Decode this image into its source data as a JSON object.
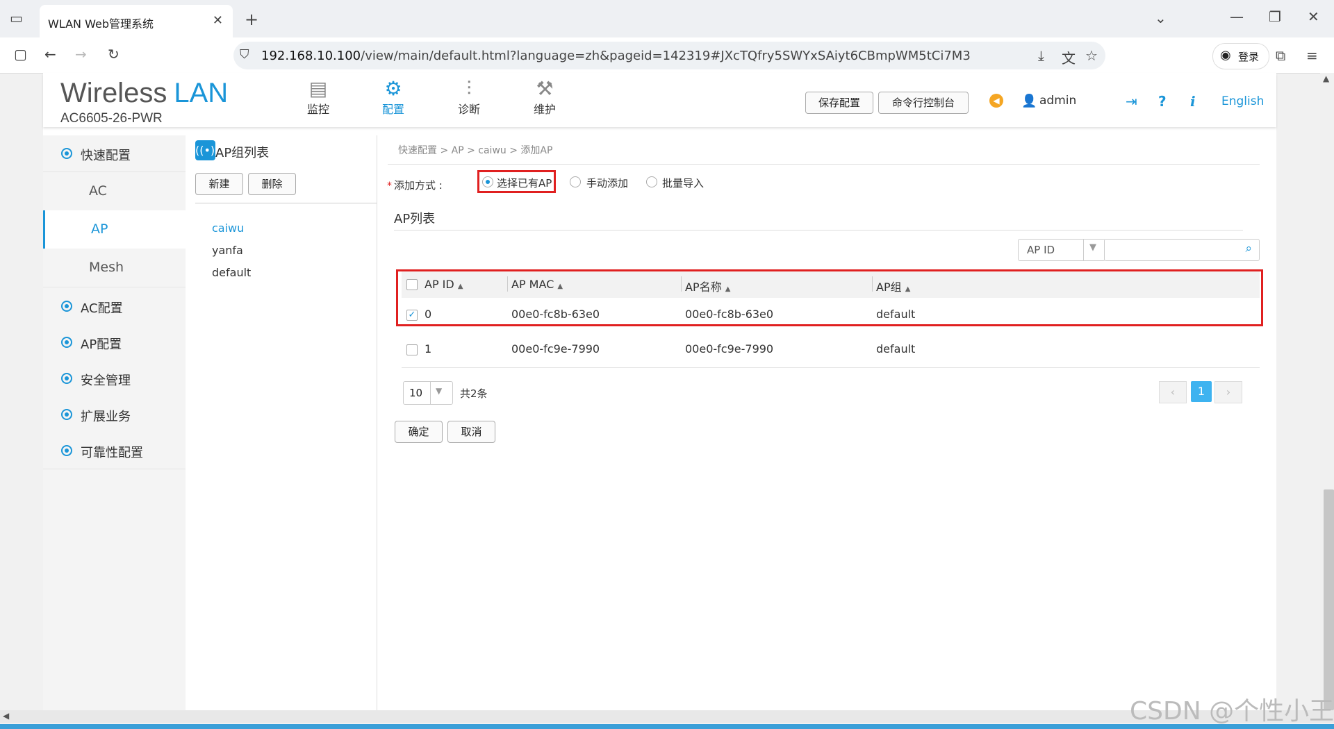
{
  "browser": {
    "tab_title": "WLAN Web管理系统",
    "url_host": "192.168.10.100",
    "url_path": "/view/main/default.html?language=zh&pageid=142319#JXcTQfry5SWYxSAiyt6CBmpWM5tCi7M3",
    "login_label": "登录"
  },
  "header": {
    "brand_wireless": "Wireless",
    "brand_lan": "LAN",
    "model": "AC6605-26-PWR",
    "nav": [
      {
        "label": "监控",
        "icon": "monitor-icon"
      },
      {
        "label": "配置",
        "icon": "gear-icon"
      },
      {
        "label": "诊断",
        "icon": "diagnose-icon"
      },
      {
        "label": "维护",
        "icon": "maintain-icon"
      }
    ],
    "save_config": "保存配置",
    "cli_console": "命令行控制台",
    "user": "admin",
    "language": "English"
  },
  "sidebar": {
    "quick_config": "快速配置",
    "sub_items": [
      "AC",
      "AP",
      "Mesh"
    ],
    "items": [
      "AC配置",
      "AP配置",
      "安全管理",
      "扩展业务",
      "可靠性配置"
    ]
  },
  "group_panel": {
    "title": "AP组列表",
    "new_button": "新建",
    "delete_button": "删除",
    "groups": [
      "caiwu",
      "yanfa",
      "default"
    ]
  },
  "content": {
    "breadcrumb": "快速配置 > AP > caiwu > 添加AP",
    "add_method_label": "添加方式 :",
    "add_methods": [
      "选择已有AP",
      "手动添加",
      "批量导入"
    ],
    "ap_list_title": "AP列表",
    "search_field": "AP ID",
    "table": {
      "headers": [
        "AP ID",
        "AP MAC",
        "AP名称",
        "AP组"
      ],
      "rows": [
        {
          "id": "0",
          "mac": "00e0-fc8b-63e0",
          "name": "00e0-fc8b-63e0",
          "group": "default",
          "checked": true
        },
        {
          "id": "1",
          "mac": "00e0-fc9e-7990",
          "name": "00e0-fc9e-7990",
          "group": "default",
          "checked": false
        }
      ]
    },
    "page_size": "10",
    "total": "共2条",
    "current_page": "1",
    "confirm": "确定",
    "cancel": "取消"
  },
  "watermark": "CSDN @个性小王",
  "colors": {
    "accent": "#1a95d8",
    "highlight_box": "#e02020",
    "page_current": "#3eb3f0"
  }
}
